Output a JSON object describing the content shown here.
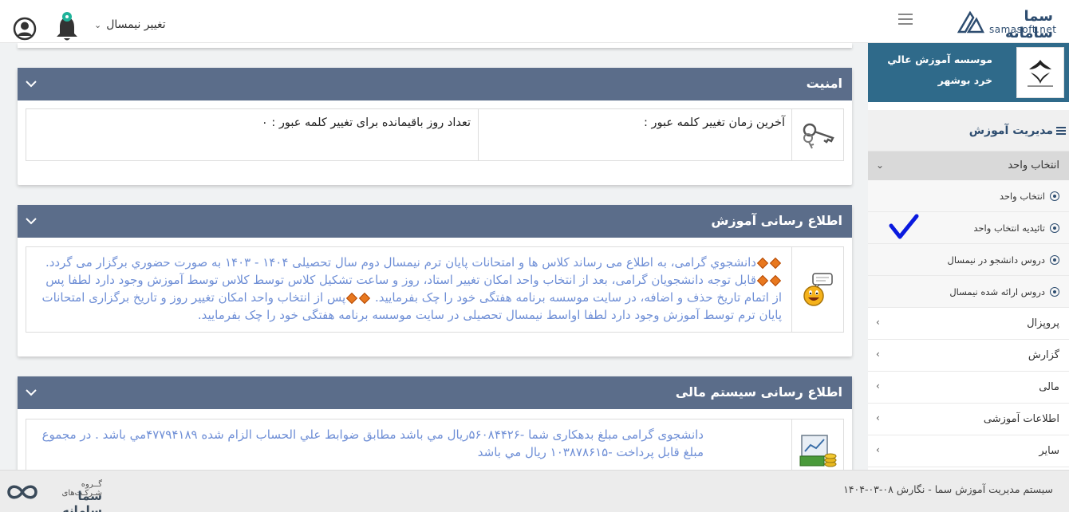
{
  "header": {
    "semester_label": "تغییر نیمسال",
    "logo_text": "سما سامانه",
    "logo_sub": "samasoft.net"
  },
  "security": {
    "title": "امنیت",
    "last_change_label": "آخرین زمان تغییر کلمه عبور :",
    "days_remaining_label": "تعداد روز باقیمانده برای تغییر کلمه عبور : ۰"
  },
  "education_notice": {
    "title": "اطلاع رسانی آموزش",
    "line1": "دانشجوي گرامی، به اطلاع می رساند کلاس ها و امتحانات پايان ترم نيمسال دوم سال تحصيلی ۱۴۰۴ - ۱۴۰۳ به صورت حضوري برگزار می گردد.",
    "line2": "قابل توجه دانشجويان گرامی، بعد از انتخاب واحد امکان تغيير استاد، روز و ساعت تشکيل کلاس توسط کلاس توسط آموزش وجود دارد لطفا پس از اتمام تاريخ حذف و اضافه، در سايت موسسه برنامه هفتگی خود را چک بفرماييد.",
    "line3": "پس از انتخاب واحد امکان تغيير روز و تاريخ برگزاری امتحانات پايان ترم توسط آموزش وجود دارد لطفا اواسط نيمسال تحصيلی در سايت موسسه برنامه هفتگی خود را چک بفرماييد."
  },
  "finance_notice": {
    "title": "اطلاع رسانی سیستم مالی",
    "text": "دانشجوی گرامی مبلغ بدهکاری شما -۵۶۰۸۴۴۲۶ريال مي باشد مطابق ضوابط علي الحساب الزام شده ۴۷۷۹۴۱۸۹مي باشد . در مجموع مبلغ قابل پرداخت -۱۰۳۸۷۸۶۱۵ ريال مي باشد"
  },
  "sidebar": {
    "institution_name": "موسسه آموزش عالي خرد بوشهر",
    "menu_title": "مدیریت آموزش",
    "open_group": "انتخاب واحد",
    "sub_items": [
      {
        "label": "انتخاب واحد"
      },
      {
        "label": "تائیدیه انتخاب واحد"
      },
      {
        "label": "دروس دانشجو در نیمسال"
      },
      {
        "label": "دروس ارائه شده نیمسال"
      }
    ],
    "items": [
      {
        "label": "پروپزال"
      },
      {
        "label": "گزارش"
      },
      {
        "label": "مالی"
      },
      {
        "label": "اطلاعات آموزشی"
      },
      {
        "label": "سایر"
      }
    ]
  },
  "footer": {
    "text": "سیستم مدیریت آموزش سما - نگارش ۰۸-۰۳-۱۴۰۴",
    "logo_top": "گــروه شـرکـت‌های",
    "logo_brand": "سما سامانه"
  },
  "colors": {
    "panel_header": "#5b6d8a",
    "info_text": "#6f8fd6",
    "sidebar_card": "#2f6a8a",
    "check_mark": "#0a1adf"
  }
}
